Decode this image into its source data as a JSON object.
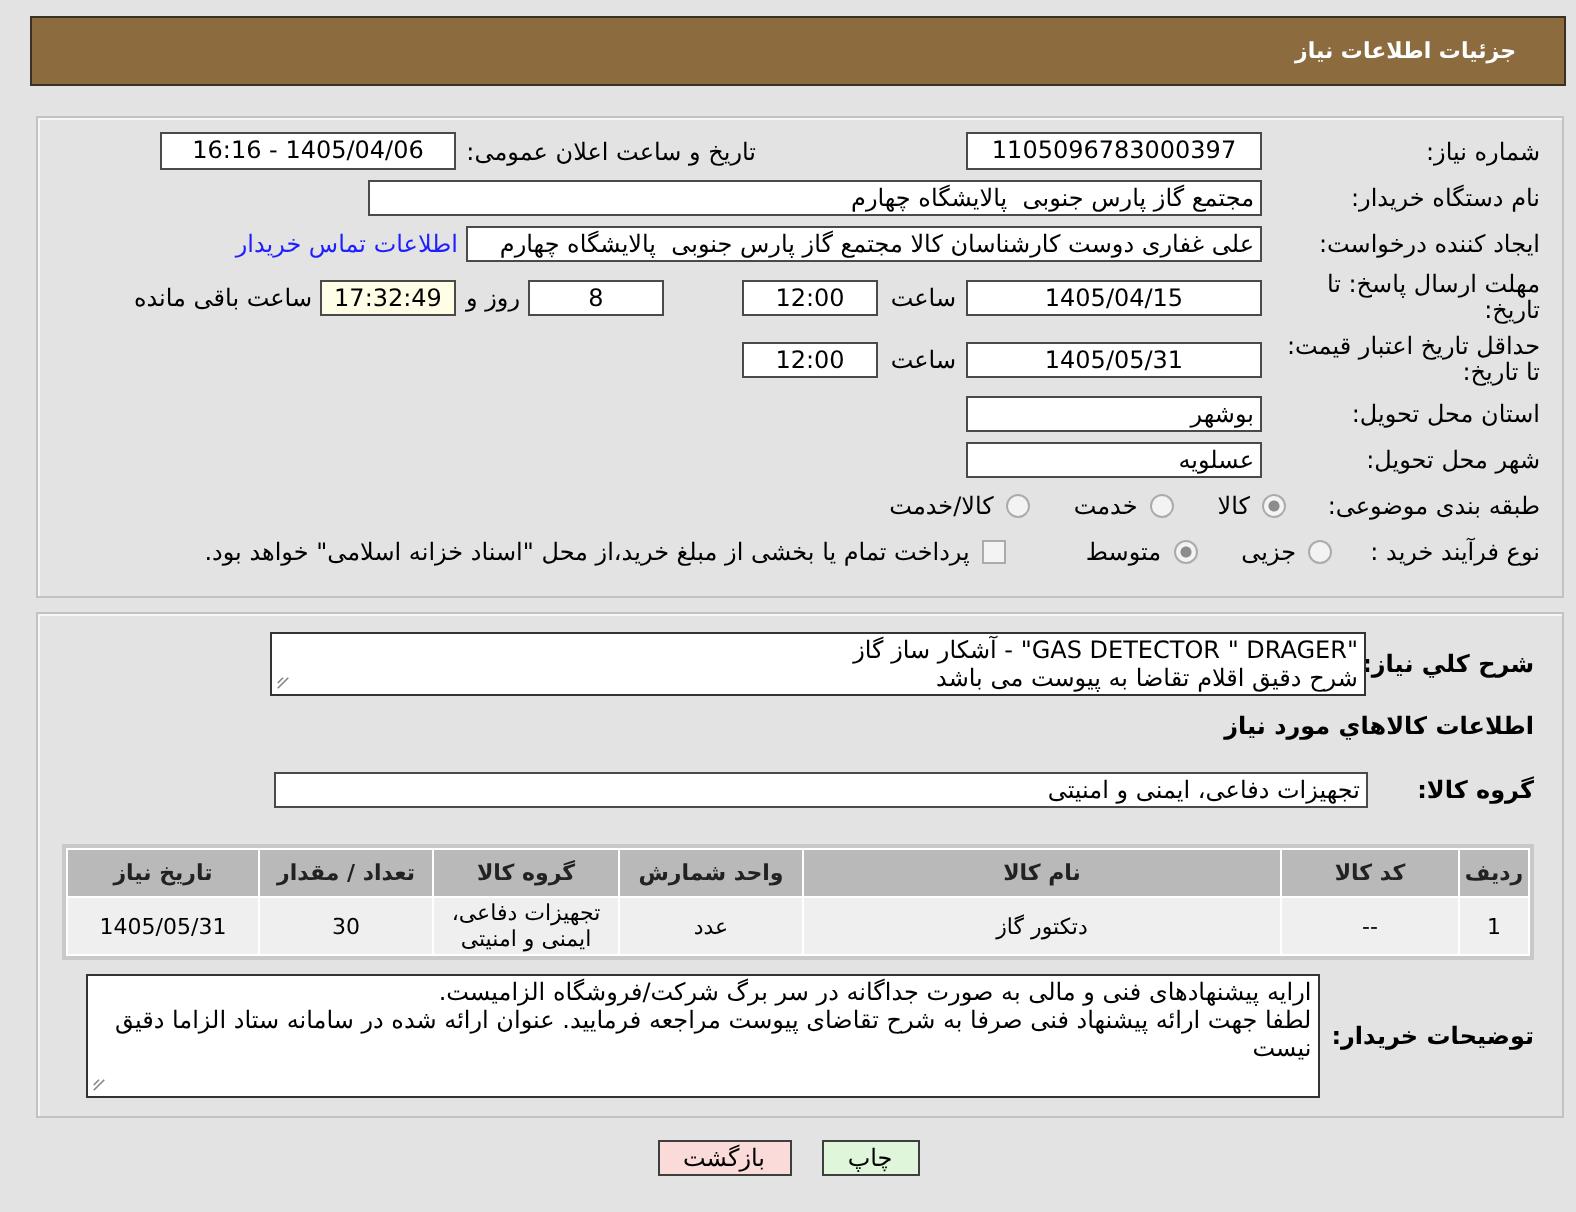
{
  "header": {
    "title": "جزئیات اطلاعات نیاز"
  },
  "details": {
    "need_number": {
      "label": "شماره نیاز:",
      "value": "1105096783000397"
    },
    "announce_datetime": {
      "label": "تاریخ و ساعت اعلان عمومی:",
      "value": "1405/04/06 - 16:16"
    },
    "buyer_org": {
      "label": "نام دستگاه خریدار:",
      "value": "مجتمع گاز پارس جنوبی  پالایشگاه چهارم"
    },
    "requester": {
      "label": "ایجاد کننده درخواست:",
      "value": "علی غفاری دوست کارشناسان کالا مجتمع گاز پارس جنوبی  پالایشگاه چهارم",
      "contact_link": "اطلاعات تماس خریدار"
    },
    "response_deadline": {
      "label_lines": [
        "مهلت ارسال پاسخ: تا",
        "تاریخ:"
      ],
      "date": "1405/04/15",
      "time_label": "ساعت",
      "time": "12:00",
      "days": "8",
      "days_label": "روز و",
      "remaining_time": "17:32:49",
      "remaining_label": "ساعت باقی مانده"
    },
    "price_validity": {
      "label_lines": [
        "حداقل تاریخ اعتبار قیمت:",
        "تا تاریخ:"
      ],
      "date": "1405/05/31",
      "time_label": "ساعت",
      "time": "12:00"
    },
    "delivery_province": {
      "label": "استان محل تحویل:",
      "value": "بوشهر"
    },
    "delivery_city": {
      "label": "شهر محل تحویل:",
      "value": "عسلویه"
    },
    "category": {
      "label": "طبقه بندی موضوعی:",
      "options": [
        {
          "label": "کالا",
          "selected": true
        },
        {
          "label": "خدمت",
          "selected": false
        },
        {
          "label": "کالا/خدمت",
          "selected": false
        }
      ]
    },
    "purchase_process": {
      "label": "نوع فرآیند خرید :",
      "options": [
        {
          "label": "جزیی",
          "selected": false
        },
        {
          "label": "متوسط",
          "selected": true
        }
      ],
      "treasury_payment": {
        "label": "پرداخت تمام یا بخشی از مبلغ خرید،از محل \"اسناد خزانه اسلامی\" خواهد بود.",
        "checked": false
      }
    }
  },
  "need": {
    "description": {
      "label": "شرح کلي نياز:",
      "value": "\"GAS DETECTOR \" DRAGER\" - آشکار ساز گاز\nشرح دقیق اقلام تقاضا به پیوست می باشد"
    },
    "items_heading": "اطلاعات کالاهاي مورد نياز",
    "item_group": {
      "label": "گروه کالا:",
      "value": "تجهیزات دفاعی، ایمنی و امنیتی"
    },
    "table": {
      "columns": [
        "ردیف",
        "کد کالا",
        "نام کالا",
        "واحد شمارش",
        "گروه کالا",
        "تعداد / مقدار",
        "تاریخ نیاز"
      ],
      "rows": [
        [
          "1",
          "--",
          "دتکتور گاز",
          "عدد",
          "تجهیزات دفاعی، ایمنی و امنیتی",
          "30",
          "1405/05/31"
        ]
      ]
    },
    "buyer_notes": {
      "label": "توضیحات خریدار:",
      "value": "ارایه پیشنهادهای فنی و مالی به صورت جداگانه در سر برگ شرکت/فروشگاه الزامیست.\nلطفا جهت ارائه پیشنهاد فنی صرفا به شرح تقاضای پیوست مراجعه فرمایید. عنوان ارائه شده در سامانه ستاد الزاما دقیق نیست"
    }
  },
  "buttons": [
    {
      "label": "چاپ",
      "kind": "print"
    },
    {
      "label": "بازگشت",
      "kind": "back"
    }
  ]
}
